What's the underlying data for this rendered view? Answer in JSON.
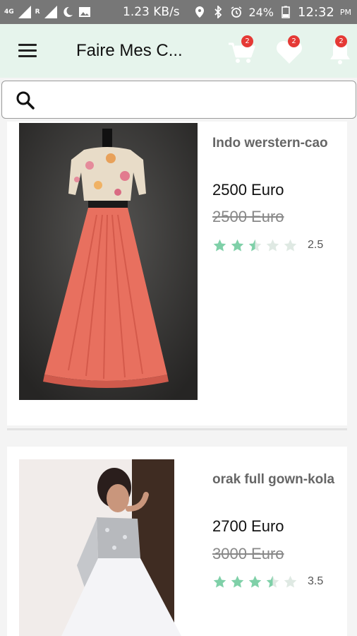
{
  "status_bar": {
    "network": "4G",
    "roaming": "R",
    "speed": "1.23 KB/s",
    "battery": "24%",
    "time": "12:32",
    "ampm": "PM"
  },
  "app_bar": {
    "title": "Faire Mes C...",
    "cart_badge": "2",
    "wishlist_badge": "2",
    "notifications_badge": "2",
    "accent": "#e6f4ec"
  },
  "search": {
    "placeholder": "",
    "value": ""
  },
  "products": [
    {
      "name": "Indo werstern-cao",
      "price": "2500 Euro",
      "old_price": "2500 Euro",
      "rating": 2.5,
      "rating_label": "2.5"
    },
    {
      "name": "orak full gown-kola",
      "price": "2700 Euro",
      "old_price": "3000 Euro",
      "rating": 3.5,
      "rating_label": "3.5"
    }
  ],
  "colors": {
    "star": "#7fd0a8",
    "star_empty": "#dfe9e3",
    "badge": "#e53935"
  }
}
